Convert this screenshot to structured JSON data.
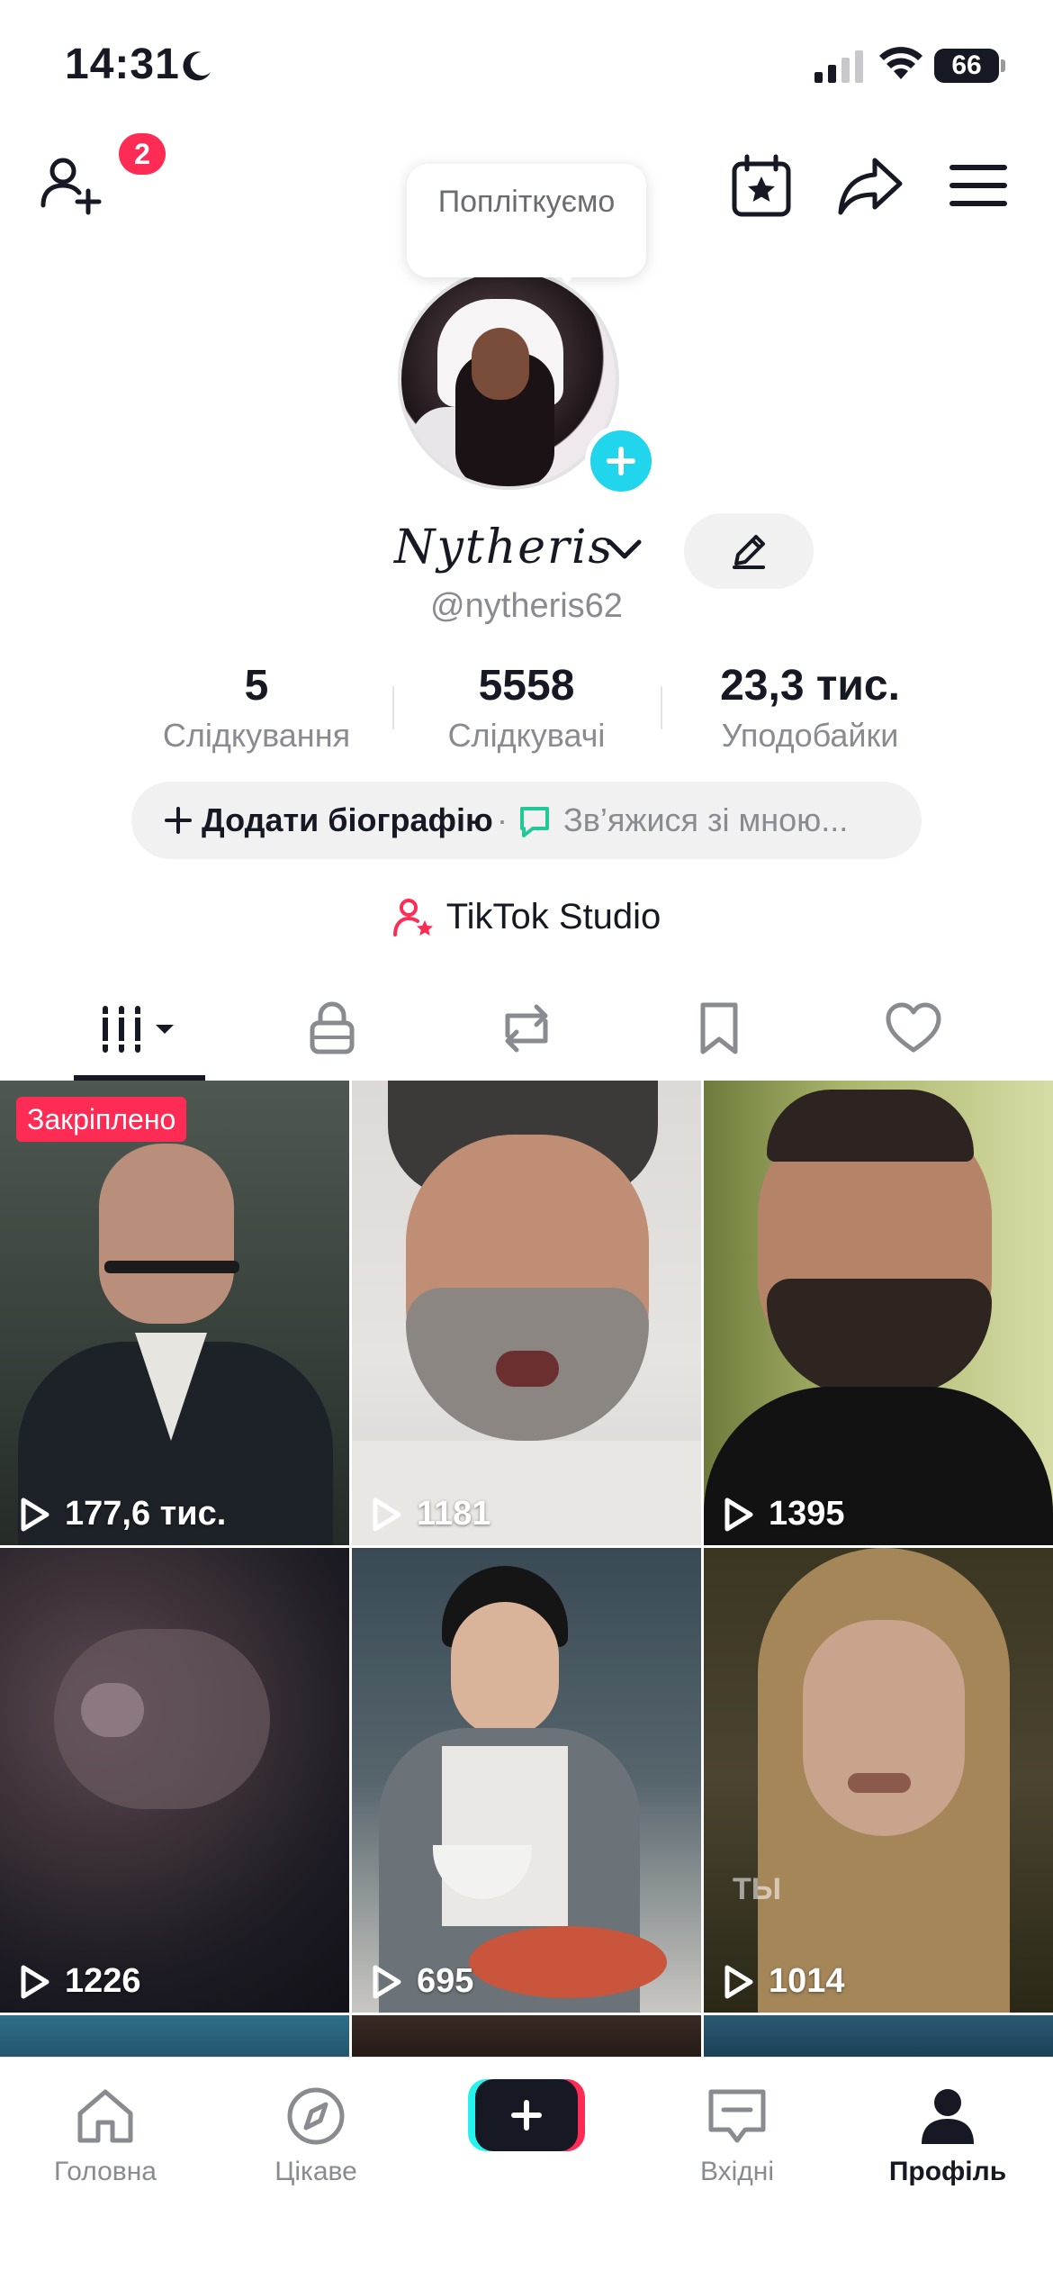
{
  "status_bar": {
    "time": "14:31",
    "battery": "66"
  },
  "top_bar": {
    "notification_count": "2"
  },
  "profile": {
    "tooltip": "Попліткуємо",
    "display_name": "Nytheris",
    "username": "@nytheris62",
    "stats": [
      {
        "value": "5",
        "label": "Слідкування"
      },
      {
        "value": "5558",
        "label": "Слідкувачі"
      },
      {
        "value": "23,3 тис.",
        "label": "Уподобайки"
      }
    ],
    "bio_add": "Додати біографію",
    "bio_separator": "·",
    "contact": "Зв’яжися зі мною...",
    "studio": "TikTok Studio"
  },
  "videos": [
    {
      "views": "177,6 тис.",
      "pinned": "Закріплено"
    },
    {
      "views": "1181"
    },
    {
      "views": "1395"
    },
    {
      "views": "1226"
    },
    {
      "views": "695"
    },
    {
      "views": "1014",
      "overlay_text": "ТЫ"
    }
  ],
  "bottom_nav": {
    "home": "Головна",
    "discover": "Цікаве",
    "inbox": "Вхідні",
    "profile": "Профіль"
  },
  "colors": {
    "accent": "#fe2c55",
    "cyan": "#25f4ee",
    "avatar_add": "#20d5ec",
    "text": "#161823",
    "muted": "#8a8b91"
  }
}
